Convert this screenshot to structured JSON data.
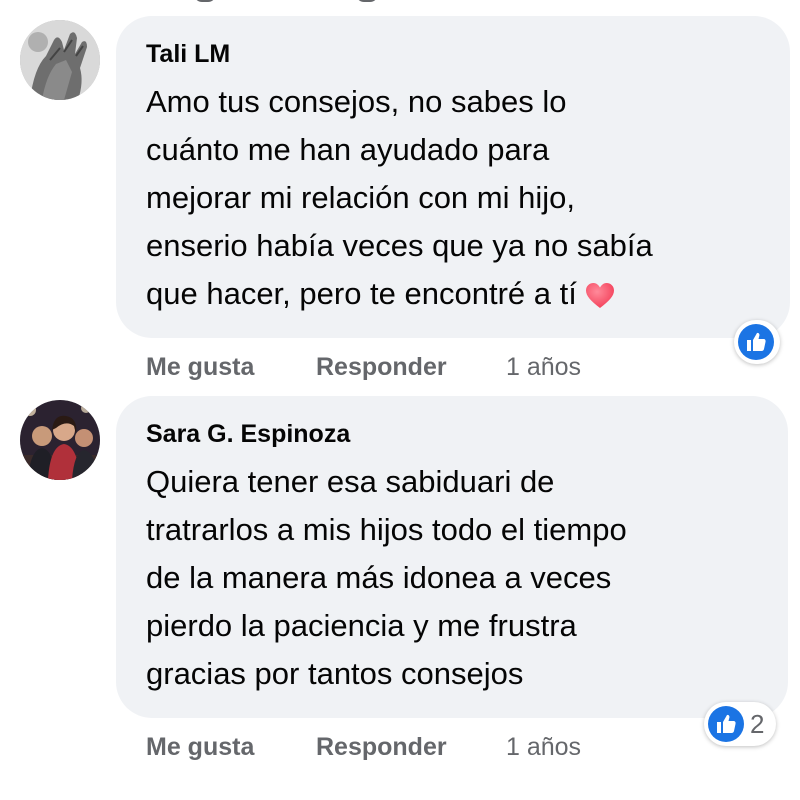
{
  "comments": [
    {
      "author": "Tali LM",
      "lines": [
        "Amo tus consejos, no sabes lo",
        "cuánto me han ayudado para",
        "mejorar mi relación con mi hijo,",
        "enserio había veces que ya no sabía",
        "que hacer, pero te encontré a tí"
      ],
      "trailing_icon": "heart-icon",
      "like_label": "Me gusta",
      "reply_label": "Responder",
      "time": "1 años",
      "reaction_icon": "like-icon",
      "reaction_count": ""
    },
    {
      "author": "Sara G. Espinoza",
      "lines": [
        "Quiera tener esa sabiduari de",
        "tratrarlos a mis hijos todo el tiempo",
        "de la manera más idonea a veces",
        "pierdo la paciencia y me frustra",
        "gracias por tantos consejos"
      ],
      "like_label": "Me gusta",
      "reply_label": "Responder",
      "time": "1 años",
      "reaction_icon": "like-icon",
      "reaction_count": "2"
    }
  ],
  "colors": {
    "bubble": "#f0f2f5",
    "text": "#050505",
    "secondary": "#65676b",
    "like_blue": "#1b74e4",
    "heart": "#f33e58"
  }
}
